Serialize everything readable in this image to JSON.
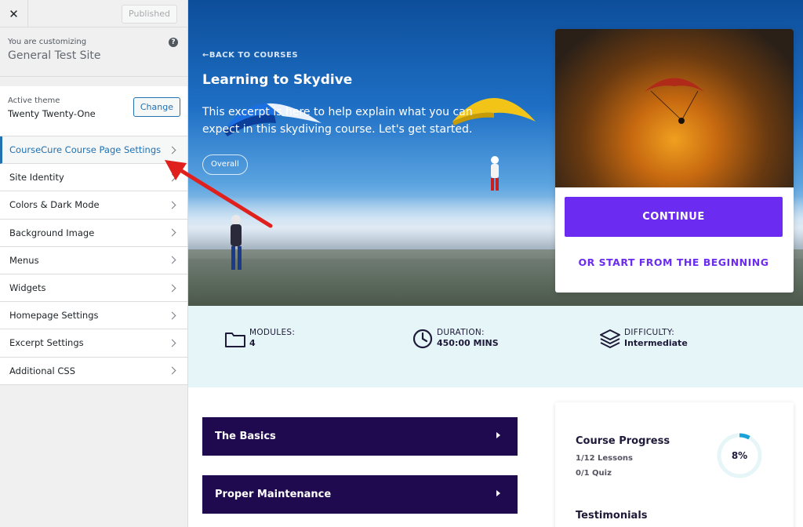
{
  "sidebar": {
    "published_label": "Published",
    "customizing_label": "You are customizing",
    "site_name": "General Test Site",
    "active_theme_label": "Active theme",
    "theme_name": "Twenty Twenty-One",
    "change_label": "Change",
    "items": [
      {
        "label": "CourseCure Course Page Settings"
      },
      {
        "label": "Site Identity"
      },
      {
        "label": "Colors & Dark Mode"
      },
      {
        "label": "Background Image"
      },
      {
        "label": "Menus"
      },
      {
        "label": "Widgets"
      },
      {
        "label": "Homepage Settings"
      },
      {
        "label": "Excerpt Settings"
      },
      {
        "label": "Additional CSS"
      }
    ]
  },
  "hero": {
    "back_link": "BACK TO COURSES",
    "title": "Learning to Skydive",
    "excerpt": "This excerpt is here to help explain what you can expect in this skydiving course. Let's get started.",
    "pill": "Overall"
  },
  "card": {
    "continue_label": "CONTINUE",
    "start_label": "OR START FROM THE BEGINNING"
  },
  "stats": {
    "modules_label": "MODULES:",
    "modules_value": "4",
    "duration_label": "DURATION:",
    "duration_value": "450:00 MINS",
    "difficulty_label": "DIFFICULTY:",
    "difficulty_value": "Intermediate"
  },
  "modules": [
    {
      "title": "The Basics"
    },
    {
      "title": "Proper Maintenance"
    }
  ],
  "progress": {
    "title": "Course Progress",
    "lessons": "1/12 Lessons",
    "quiz": "0/1 Quiz",
    "percent": "8%",
    "percent_value": 8,
    "testimonials": "Testimonials"
  },
  "colors": {
    "accent": "#6b2bf0",
    "module_bg": "#200a4f",
    "progress_ring": "#1aa3d8",
    "wp_blue": "#2271b1",
    "annotation_arrow": "#e0201d"
  }
}
